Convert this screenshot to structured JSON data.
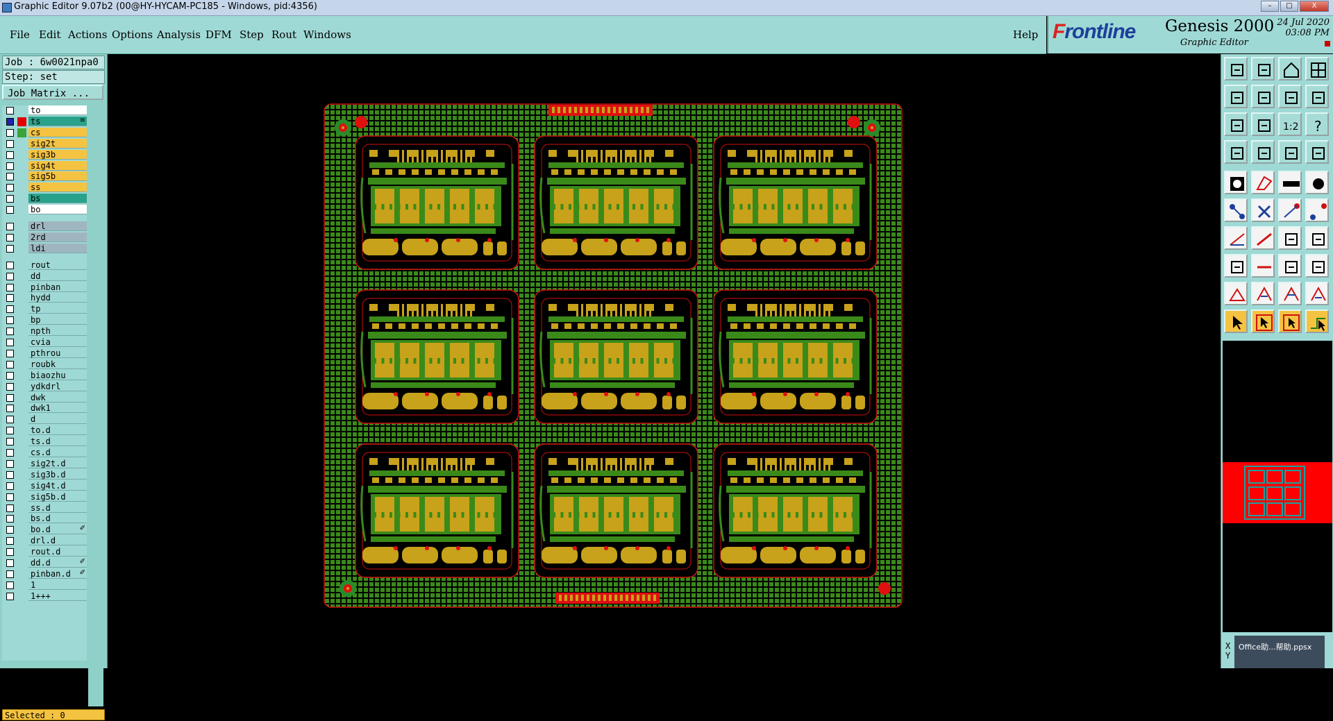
{
  "window": {
    "title": "Graphic Editor 9.07b2 (00@HY-HYCAM-PC185 - Windows, pid:4356)",
    "minimize": "–",
    "maximize": "□",
    "close": "X"
  },
  "menu": {
    "items": [
      "File",
      "Edit",
      "Actions",
      "Options",
      "Analysis",
      "DFM",
      "Step",
      "Rout",
      "Windows"
    ],
    "help": "Help"
  },
  "brand": {
    "logo_a": "F",
    "logo_b": "rontline",
    "product": "Genesis 2000",
    "subtitle": "Graphic Editor",
    "date": "24 Jul 2020",
    "time": "03:08 PM"
  },
  "job": {
    "job_line": "Job : 6w0021npa0",
    "step_line": "Step: set",
    "matrix_button": "Job Matrix ..."
  },
  "layers": [
    {
      "name": "to",
      "color": "#ffffff",
      "mark": "",
      "group": 0
    },
    {
      "name": "ts",
      "color": "#2aa18a",
      "mark": "#e00000",
      "group": 0,
      "icon": "≡",
      "active": true
    },
    {
      "name": "cs",
      "color": "#f5c342",
      "mark": "#3aa33a",
      "group": 0
    },
    {
      "name": "sig2t",
      "color": "#f5c342",
      "mark": "",
      "group": 0
    },
    {
      "name": "sig3b",
      "color": "#f5c342",
      "mark": "",
      "group": 0
    },
    {
      "name": "sig4t",
      "color": "#f5c342",
      "mark": "",
      "group": 0
    },
    {
      "name": "sig5b",
      "color": "#f5c342",
      "mark": "",
      "group": 0
    },
    {
      "name": "ss",
      "color": "#f5c342",
      "mark": "",
      "group": 0
    },
    {
      "name": "bs",
      "color": "#2aa18a",
      "mark": "",
      "group": 0
    },
    {
      "name": "bo",
      "color": "#ffffff",
      "mark": "",
      "group": 0
    },
    {
      "name": "drl",
      "color": "#9fb6c0",
      "mark": "",
      "group": 1
    },
    {
      "name": "2rd",
      "color": "#9fb6c0",
      "mark": "",
      "group": 1
    },
    {
      "name": "ldi",
      "color": "#9fb6c0",
      "mark": "",
      "group": 1
    },
    {
      "name": "rout",
      "color": "#9fd9d5",
      "mark": "",
      "group": 2
    },
    {
      "name": "dd",
      "color": "#9fd9d5",
      "mark": "",
      "group": 2
    },
    {
      "name": "pinban",
      "color": "#9fd9d5",
      "mark": "",
      "group": 2
    },
    {
      "name": "hydd",
      "color": "#9fd9d5",
      "mark": "",
      "group": 2
    },
    {
      "name": "tp",
      "color": "#9fd9d5",
      "mark": "",
      "group": 2
    },
    {
      "name": "bp",
      "color": "#9fd9d5",
      "mark": "",
      "group": 2
    },
    {
      "name": "npth",
      "color": "#9fd9d5",
      "mark": "",
      "group": 2
    },
    {
      "name": "cvia",
      "color": "#9fd9d5",
      "mark": "",
      "group": 2
    },
    {
      "name": "pthrou",
      "color": "#9fd9d5",
      "mark": "",
      "group": 2
    },
    {
      "name": "roubk",
      "color": "#9fd9d5",
      "mark": "",
      "group": 2
    },
    {
      "name": "biaozhu",
      "color": "#9fd9d5",
      "mark": "",
      "group": 2
    },
    {
      "name": "ydkdrl",
      "color": "#9fd9d5",
      "mark": "",
      "group": 2
    },
    {
      "name": "dwk",
      "color": "#9fd9d5",
      "mark": "",
      "group": 2
    },
    {
      "name": "dwk1",
      "color": "#9fd9d5",
      "mark": "",
      "group": 2
    },
    {
      "name": "d",
      "color": "#9fd9d5",
      "mark": "",
      "group": 2
    },
    {
      "name": "to.d",
      "color": "#9fd9d5",
      "mark": "",
      "group": 2
    },
    {
      "name": "ts.d",
      "color": "#9fd9d5",
      "mark": "",
      "group": 2
    },
    {
      "name": "cs.d",
      "color": "#9fd9d5",
      "mark": "",
      "group": 2
    },
    {
      "name": "sig2t.d",
      "color": "#9fd9d5",
      "mark": "",
      "group": 2
    },
    {
      "name": "sig3b.d",
      "color": "#9fd9d5",
      "mark": "",
      "group": 2
    },
    {
      "name": "sig4t.d",
      "color": "#9fd9d5",
      "mark": "",
      "group": 2
    },
    {
      "name": "sig5b.d",
      "color": "#9fd9d5",
      "mark": "",
      "group": 2
    },
    {
      "name": "ss.d",
      "color": "#9fd9d5",
      "mark": "",
      "group": 2
    },
    {
      "name": "bs.d",
      "color": "#9fd9d5",
      "mark": "",
      "group": 2
    },
    {
      "name": "bo.d",
      "color": "#9fd9d5",
      "mark": "",
      "group": 2,
      "icon": "✐"
    },
    {
      "name": "drl.d",
      "color": "#9fd9d5",
      "mark": "",
      "group": 2
    },
    {
      "name": "rout.d",
      "color": "#9fd9d5",
      "mark": "",
      "group": 2
    },
    {
      "name": "dd.d",
      "color": "#9fd9d5",
      "mark": "",
      "group": 2,
      "icon": "✐"
    },
    {
      "name": "pinban.d",
      "color": "#9fd9d5",
      "mark": "",
      "group": 2,
      "icon": "✐"
    },
    {
      "name": "1",
      "color": "#9fd9d5",
      "mark": "",
      "group": 2
    },
    {
      "name": "1+++",
      "color": "#9fd9d5",
      "mark": "",
      "group": 2
    }
  ],
  "status": {
    "selected": "Selected : 0"
  },
  "coords": {
    "x": "X",
    "y": "Y"
  },
  "taskbar_popup": {
    "label": "Office助...帮助.ppsx"
  },
  "colors": {
    "panel": "#9fd9d5",
    "copper": "#c7a21a",
    "mask": "#3a8a1a",
    "outline": "#d01010",
    "thumb": "#ff0000"
  },
  "toolbar_icons": [
    "layer-up-icon",
    "layer-down-icon",
    "home-icon",
    "window-icon",
    "zoom-left-icon",
    "zoom-right-icon",
    "pan-icon",
    "redraw-icon",
    "fit-icon",
    "center-icon",
    "scale-icon",
    "help-icon",
    "snap-icon",
    "measure-icon",
    "filter-a-icon",
    "filter-b-icon",
    "pad-icon",
    "shape-icon",
    "ruler-icon",
    "circle-icon",
    "node-icon",
    "cross-icon",
    "line-node-icon",
    "line-node2-icon",
    "line-icon",
    "diag-line-icon",
    "arc-icon",
    "array-icon",
    "corner-icon",
    "hline-icon",
    "bracket-icon",
    "copy-icon",
    "triangle-a-icon",
    "triangle-b-icon",
    "triangle-c-icon",
    "triangle-d-icon",
    "pointer-icon",
    "pointer-box-icon",
    "pointer-move-icon",
    "route-icon"
  ]
}
